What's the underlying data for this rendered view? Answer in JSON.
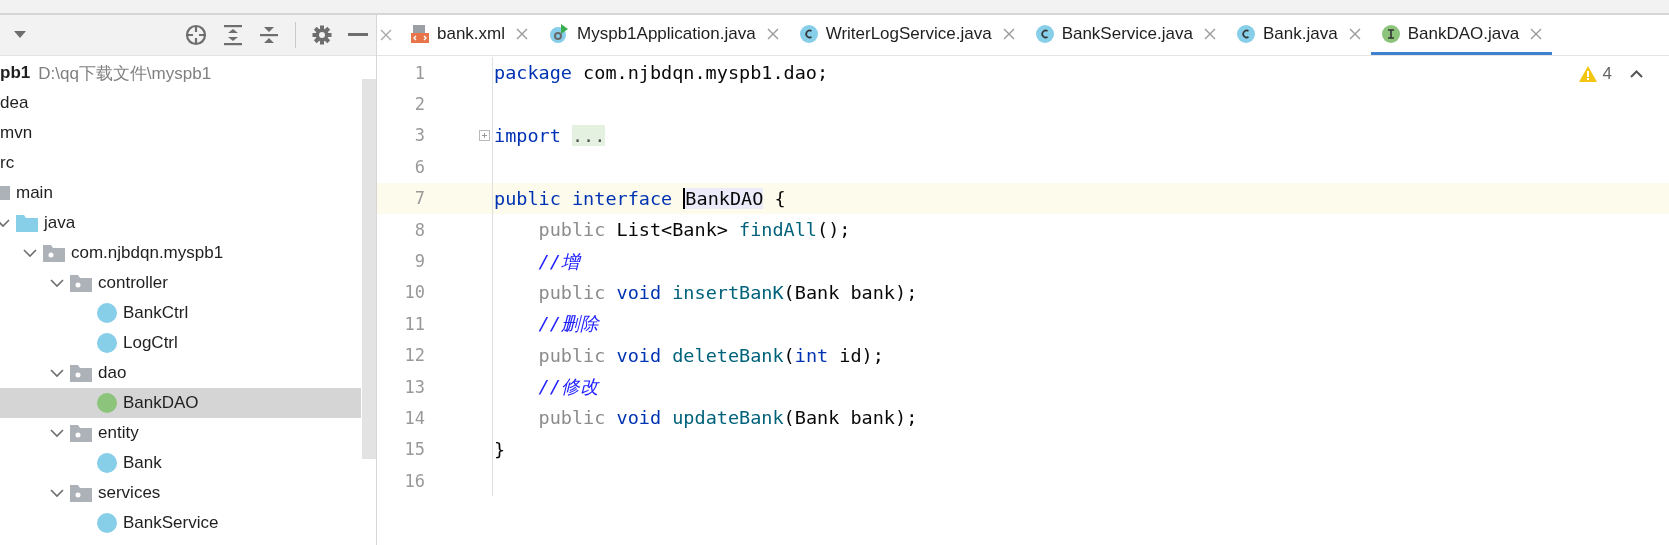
{
  "project": {
    "root": {
      "name": "pb1",
      "path": "D:\\qq下载文件\\myspb1"
    },
    "tree": [
      {
        "label": "dea",
        "selected": false
      },
      {
        "label": "mvn",
        "selected": false
      },
      {
        "label": "rc",
        "selected": false,
        "children": [
          {
            "label": "main",
            "kind": "folder-grey",
            "selected": false,
            "children": [
              {
                "label": "java",
                "kind": "folder-blue",
                "expanded": true,
                "selected": false,
                "children": [
                  {
                    "label": "com.njbdqn.myspb1",
                    "kind": "package",
                    "expanded": true,
                    "selected": false,
                    "children": [
                      {
                        "label": "controller",
                        "kind": "package",
                        "expanded": true,
                        "selected": false,
                        "children": [
                          {
                            "label": "BankCtrl",
                            "kind": "class",
                            "selected": false
                          },
                          {
                            "label": "LogCtrl",
                            "kind": "class",
                            "selected": false
                          }
                        ]
                      },
                      {
                        "label": "dao",
                        "kind": "package",
                        "expanded": true,
                        "selected": false,
                        "children": [
                          {
                            "label": "BankDAO",
                            "kind": "interface",
                            "selected": true
                          }
                        ]
                      },
                      {
                        "label": "entity",
                        "kind": "package",
                        "expanded": true,
                        "selected": false,
                        "children": [
                          {
                            "label": "Bank",
                            "kind": "class",
                            "selected": false
                          }
                        ]
                      },
                      {
                        "label": "services",
                        "kind": "package",
                        "expanded": true,
                        "selected": false,
                        "children": [
                          {
                            "label": "BankService",
                            "kind": "class",
                            "selected": false
                          }
                        ]
                      }
                    ]
                  }
                ]
              }
            ]
          }
        ]
      }
    ]
  },
  "tabs": [
    {
      "label": "bank.xml",
      "kind": "xml",
      "selected": false
    },
    {
      "label": "Myspb1Application.java",
      "kind": "app",
      "selected": false
    },
    {
      "label": "WriterLogService.java",
      "kind": "class",
      "selected": false
    },
    {
      "label": "BankService.java",
      "kind": "class",
      "selected": false
    },
    {
      "label": "Bank.java",
      "kind": "class",
      "selected": false
    },
    {
      "label": "BankDAO.java",
      "kind": "interface",
      "selected": true
    }
  ],
  "inspections": {
    "warnings": "4"
  },
  "editor": {
    "lines": [
      {
        "number": "1",
        "current": false,
        "tokens": [
          {
            "text": "package",
            "kind": "keyword"
          },
          {
            "text": " com.njbdqn.myspb1.dao;",
            "kind": "plain"
          }
        ]
      },
      {
        "number": "2",
        "current": false
      },
      {
        "number": "3",
        "current": false,
        "folded": true,
        "tokens": [
          {
            "text": "import ",
            "kind": "keyword"
          },
          {
            "text": "...",
            "kind": "fold"
          }
        ]
      },
      {
        "number": "6",
        "current": false
      },
      {
        "number": "7",
        "current": true,
        "tokens": [
          {
            "text": "public interface ",
            "kind": "keyword"
          },
          {
            "text": "BankDAO",
            "kind": "caret-ident"
          },
          {
            "text": " {",
            "kind": "plain"
          }
        ]
      },
      {
        "number": "8",
        "current": false,
        "tokens": [
          {
            "text": "    public",
            "kind": "redundant"
          },
          {
            "text": " List<Bank> ",
            "kind": "plain"
          },
          {
            "text": "findAll",
            "kind": "method"
          },
          {
            "text": "();",
            "kind": "plain"
          }
        ]
      },
      {
        "number": "9",
        "current": false,
        "tokens": [
          {
            "text": "    //增",
            "kind": "comment"
          }
        ]
      },
      {
        "number": "10",
        "current": false,
        "tokens": [
          {
            "text": "    public",
            "kind": "redundant"
          },
          {
            "text": " void ",
            "kind": "keyword"
          },
          {
            "text": "insertBanK",
            "kind": "method"
          },
          {
            "text": "(Bank bank);",
            "kind": "plain"
          }
        ]
      },
      {
        "number": "11",
        "current": false,
        "tokens": [
          {
            "text": "    //删除",
            "kind": "comment"
          }
        ]
      },
      {
        "number": "12",
        "current": false,
        "tokens": [
          {
            "text": "    public",
            "kind": "redundant"
          },
          {
            "text": " void ",
            "kind": "keyword"
          },
          {
            "text": "deleteBank",
            "kind": "method"
          },
          {
            "text": "(",
            "kind": "plain"
          },
          {
            "text": "int",
            "kind": "keyword"
          },
          {
            "text": " id);",
            "kind": "plain"
          }
        ]
      },
      {
        "number": "13",
        "current": false,
        "tokens": [
          {
            "text": "    //修改",
            "kind": "comment"
          }
        ]
      },
      {
        "number": "14",
        "current": false,
        "tokens": [
          {
            "text": "    public",
            "kind": "redundant"
          },
          {
            "text": " void ",
            "kind": "keyword"
          },
          {
            "text": "updateBank",
            "kind": "method"
          },
          {
            "text": "(Bank bank);",
            "kind": "plain"
          }
        ]
      },
      {
        "number": "15",
        "current": false,
        "tokens": [
          {
            "text": "}",
            "kind": "plain"
          }
        ]
      },
      {
        "number": "16",
        "current": false
      }
    ]
  }
}
